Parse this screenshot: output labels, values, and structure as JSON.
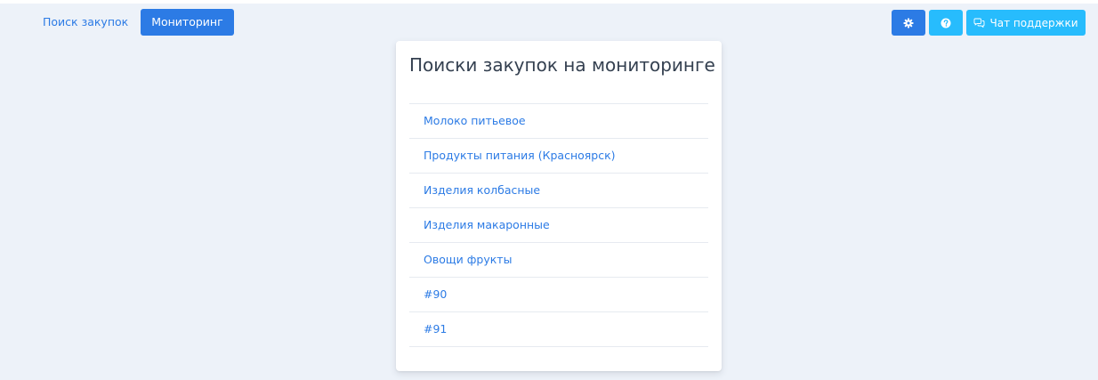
{
  "nav": {
    "items": [
      {
        "label": "Поиск закупок",
        "active": false
      },
      {
        "label": "Мониторинг",
        "active": true
      }
    ]
  },
  "toolbar": {
    "settings_icon": "gear-icon",
    "help_icon": "question-circle-icon",
    "chat_icon": "chat-bubbles-icon",
    "chat_label": "Чат поддержки"
  },
  "colors": {
    "primary": "#2c7be5",
    "info": "#27bcfd",
    "background": "#edf2f9",
    "title_text": "#344050"
  },
  "monitoring": {
    "title": "Поиски закупок на мониторинге",
    "items": [
      {
        "label": "Молоко питьевое"
      },
      {
        "label": "Продукты питания (Красноярск)"
      },
      {
        "label": "Изделия колбасные"
      },
      {
        "label": "Изделия макаронные"
      },
      {
        "label": "Овощи фрукты"
      },
      {
        "label": "#90"
      },
      {
        "label": "#91"
      }
    ]
  }
}
